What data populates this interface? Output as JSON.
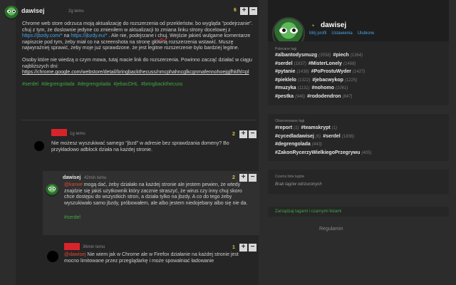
{
  "post": {
    "author": "dawisej",
    "time": "2g temu",
    "votes": "6",
    "plus": "+",
    "minus": "−",
    "para1_a": "Chrome web store odrzuca moją aktualizację do rozszerzenia od przekleństw. bo wygląda \"podejrzanie\". chuj z tym, że doslownie jedyne co zmieniłem w aktualizacji to zmiana linku strony docelowej z ",
    "link1": "https://jbzdy.com/*",
    "para1_b": " na ",
    "link2": "https://jbzdy.eu/*",
    "para1_c": " . Ale nie, podejrzane i ",
    "underline_word": "chuj",
    "para1_d": ". Wejście jakieś wulgarne komentarze napiszcie pod tym, żeby miał co na screenshota na stronę główną rozszerzenia wstawić. Muszę najwyraźniej sprawić, żeby moje już sprawdzone. że jest legitne rozszerzenie bylo bardziej legitne.",
    "para2": "Osoby które nie wiedzą o czym mowa, tutaj macie link do rozszerzenia. Powinno zacząć działać w ciągu najbliższych dni:",
    "ext_link": "https://chrome.google.com/webstore/detail/bringbackthecuss/nmcphahncglkcgnmafennohoejgjfhkfhl=pl",
    "tags": [
      "#serdel",
      "#degrengolada",
      "#degrengolada",
      "#jebacDHL",
      "#bringbackthecuss"
    ]
  },
  "comments": [
    {
      "time": "1g temu",
      "votes": "2",
      "text": "Nie możesz wyszukiwać samego \"jbzd\" w adresie bez sprawdzania domeny? Bo przykładowo adblock działa na każdej stronie."
    },
    {
      "author": "dawisej",
      "time": "42min temu",
      "votes": "2",
      "mention": "@karwe",
      "text": " mogą dać, żeby działało na każdej stronie ale jestem pewien, że wtedy znajdzie się jakiś użytkownik który zacznie straszyć, że wirus czy inny chuj skoro chce dostępu do wszystkich stron, a działa tylko na jbzdy. A co do tego żeby wyszukiwało samo jbzdy, próbowałem, ale albo jestem niedojebany albo się nie da.",
      "tag": "#serdel"
    },
    {
      "time": "36min temu",
      "votes": "1",
      "mention": "@dawisej",
      "text": " Nie wiem jak w Chrome ale w Firefox działanie na każdej stronie jest mocno limitowane przez przeglądarkę i może spowalniać ładowanie"
    }
  ],
  "sidebar": {
    "name": "dawisej",
    "links": [
      "Mój profil",
      "Ustawienia",
      "Ulubione"
    ],
    "popular_title": "Polecane tagi",
    "popular": [
      [
        {
          "t": "#albantodysmuzg",
          "c": "(3558)"
        },
        {
          "t": "#piech",
          "c": "(1364)"
        }
      ],
      [
        {
          "t": "#serdel",
          "c": "(1837)"
        },
        {
          "t": "#MisterLonely",
          "c": "(1468)"
        }
      ],
      [
        {
          "t": "#pytanie",
          "c": "(1438)"
        },
        {
          "t": "#PoProstuWyder",
          "c": "(1427)"
        }
      ],
      [
        {
          "t": "#pieklelo",
          "c": "(1322)"
        },
        {
          "t": "#jebacwykop",
          "c": "(1225)"
        }
      ],
      [
        {
          "t": "#muzyka",
          "c": "(1131)"
        },
        {
          "t": "#nohomo",
          "c": "(1061)"
        }
      ],
      [
        {
          "t": "#pestka",
          "c": "(948)"
        },
        {
          "t": "#rododendron",
          "c": "(847)"
        }
      ]
    ],
    "observed_title": "Obserwowane tagi",
    "observed": [
      [
        {
          "t": "#report",
          "c": "(1)"
        },
        {
          "t": "#teamskrypt",
          "c": "(1)"
        }
      ],
      [
        {
          "t": "#cycedladawisej",
          "c": "(6)"
        },
        {
          "t": "#serdel",
          "c": "(1836)"
        }
      ],
      [
        {
          "t": "#degrengolada",
          "c": "(443)"
        }
      ],
      [
        {
          "t": "#ZakonRycerzyWielkiegoPrzegrywu",
          "c": "(405)"
        }
      ]
    ],
    "blacklist_title": "Czarna lista tagów",
    "blacklist_empty": "Brak tagów odrzuconych",
    "manage_link": "Zarządzaj tagami i czarnymi listami",
    "regulamin": "Regulamin"
  }
}
